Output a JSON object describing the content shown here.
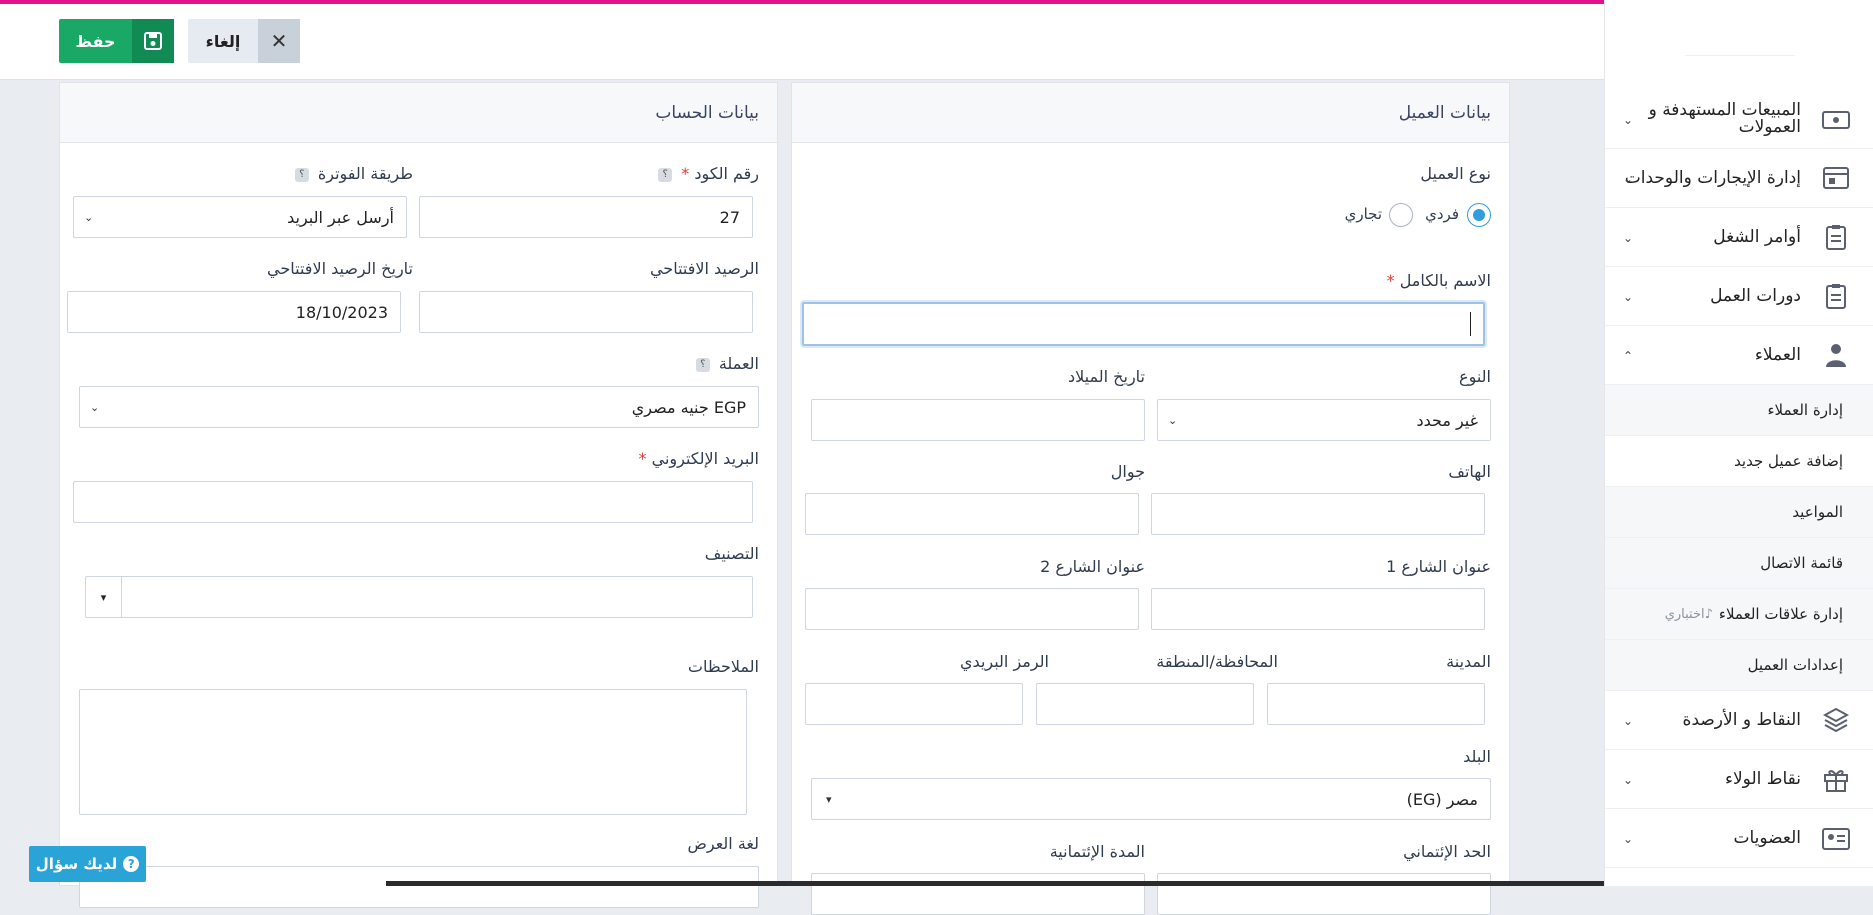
{
  "toolbar": {
    "save_label": "حفظ",
    "cancel_label": "إلغاء"
  },
  "sidebar": {
    "items": [
      {
        "label": "المبيعات المستهدفة و العمولات",
        "icon": "money-icon"
      },
      {
        "label": "إدارة الإيجارات والوحدات",
        "icon": "rental-icon"
      },
      {
        "label": "أوامر الشغل",
        "icon": "clipboard-icon"
      },
      {
        "label": "دورات العمل",
        "icon": "clipboard-icon"
      },
      {
        "label": "العملاء",
        "icon": "user-icon"
      }
    ],
    "sub_items": [
      {
        "label": "إدارة العملاء"
      },
      {
        "label": "إضافة عميل جديد"
      },
      {
        "label": "المواعيد"
      },
      {
        "label": "قائمة الاتصال"
      },
      {
        "label": "إدارة علاقات العملاء",
        "badge": "اختباري"
      },
      {
        "label": "إعدادات العميل"
      }
    ],
    "items_after": [
      {
        "label": "النقاط و الأرصدة",
        "icon": "layers-icon"
      },
      {
        "label": "نقاط الولاء",
        "icon": "gift-icon"
      },
      {
        "label": "العضويات",
        "icon": "id-card-icon"
      }
    ]
  },
  "customer": {
    "title": "بيانات العميل",
    "type_label": "نوع العميل",
    "type_individual": "فردي",
    "type_commercial": "تجاري",
    "full_name_label": "الاسم بالكامل",
    "full_name_value": "",
    "gender_label": "النوع",
    "gender_value": "غير محدد",
    "birthdate_label": "تاريخ الميلاد",
    "phone_label": "الهاتف",
    "mobile_label": "جوال",
    "street1_label": "عنوان الشارع 1",
    "street2_label": "عنوان الشارع 2",
    "city_label": "المدينة",
    "region_label": "المحافظة/المنطقة",
    "postal_label": "الرمز البريدي",
    "country_label": "البلد",
    "country_value": "مصر (EG)",
    "credit_limit_label": "الحد الإئتماني",
    "credit_period_label": "المدة الإئتمانية"
  },
  "account": {
    "title": "بيانات الحساب",
    "code_label": "رقم الكود",
    "code_value": "27",
    "invoicing_label": "طريقة الفوترة",
    "invoicing_value": "أرسل عبر البريد",
    "opening_balance_label": "الرصيد الافتتاحي",
    "opening_date_label": "تاريخ الرصيد الافتتاحي",
    "opening_date_value": "18/10/2023",
    "currency_label": "العملة",
    "currency_value": "EGP جنيه مصري",
    "email_label": "البريد الإلكتروني",
    "category_label": "التصنيف",
    "notes_label": "الملاحظات",
    "language_label": "لغة العرض"
  },
  "help_button": {
    "label": "لديك سؤال"
  },
  "help_mark": "؟",
  "required_mark": "*",
  "colors": {
    "accent": "#1aa867",
    "top_line": "#e3128c",
    "help": "#2aa3d6",
    "radio": "#2f9de0"
  }
}
